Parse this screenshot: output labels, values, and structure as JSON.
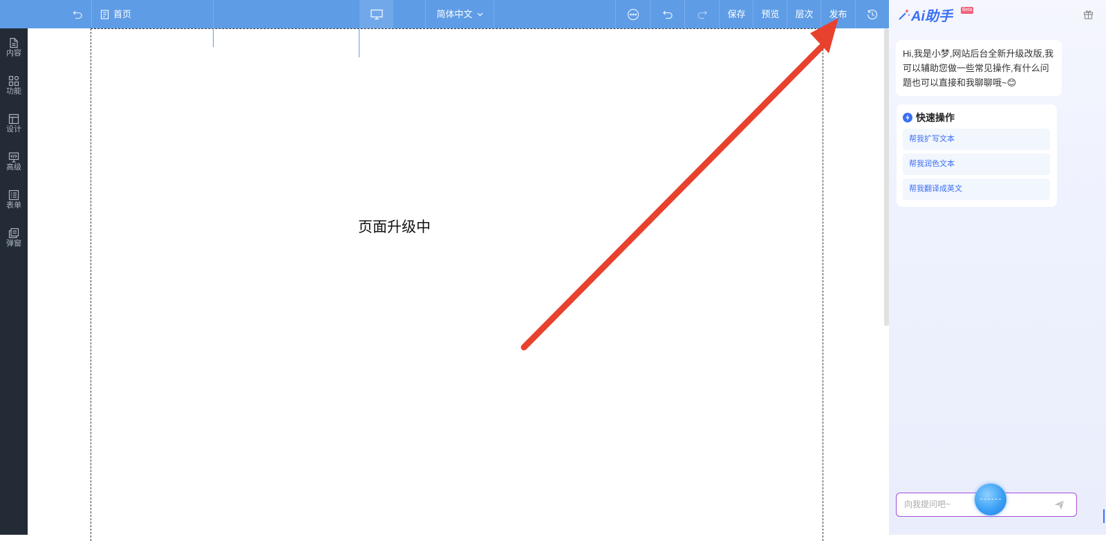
{
  "toolbar": {
    "page_label": "首页",
    "language_label": "简体中文",
    "save_label": "保存",
    "preview_label": "预览",
    "layers_label": "层次",
    "publish_label": "发布"
  },
  "sidebar": {
    "items": [
      {
        "label": "内容",
        "icon": "document-icon"
      },
      {
        "label": "功能",
        "icon": "grid-icon"
      },
      {
        "label": "设计",
        "icon": "layout-icon"
      },
      {
        "label": "高级",
        "icon": "code-icon"
      },
      {
        "label": "表单",
        "icon": "form-icon"
      },
      {
        "label": "弹窗",
        "icon": "popup-icon"
      }
    ]
  },
  "canvas": {
    "message": "页面升级中"
  },
  "ai_panel": {
    "title": "Ai助手",
    "badge": "Beta",
    "greeting": "Hi,我是小梦,网站后台全新升级改版,我可以辅助您做一些常见操作,有什么问题也可以直接和我聊聊哦~😊",
    "quick_title": "快速操作",
    "quick_actions": [
      "帮我扩写文本",
      "帮我润色文本",
      "帮我翻译成英文"
    ],
    "input_placeholder": "向我提问吧~"
  },
  "colors": {
    "topbar": "#5e9ce6",
    "sidebar": "#222b36",
    "accent": "#3b6ff5",
    "annotation_arrow": "#e8412e"
  }
}
